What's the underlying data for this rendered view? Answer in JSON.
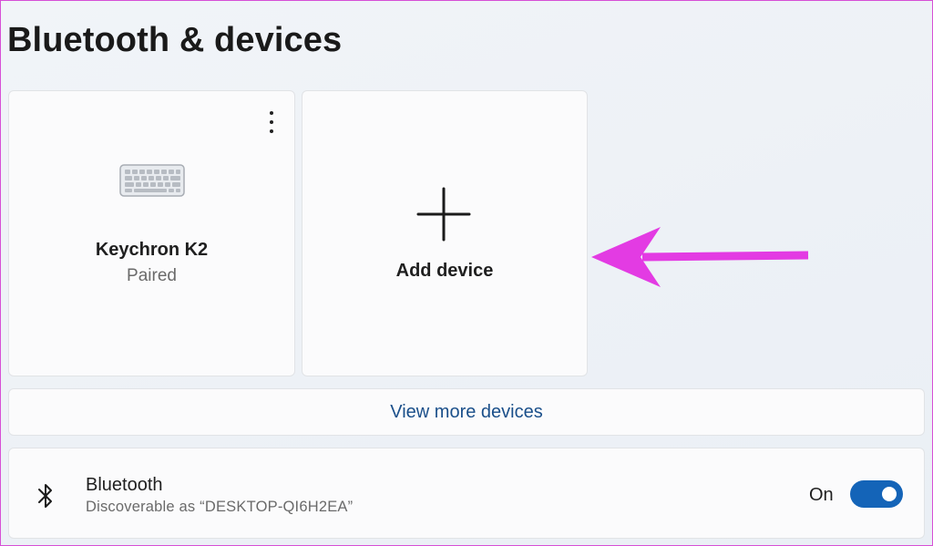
{
  "page": {
    "title": "Bluetooth & devices"
  },
  "device_card": {
    "name": "Keychron K2",
    "status": "Paired",
    "icon": "keyboard-icon",
    "menu_icon": "more-vertical-icon"
  },
  "add_card": {
    "label": "Add device",
    "icon": "plus-icon"
  },
  "view_more": {
    "label": "View more devices"
  },
  "bluetooth": {
    "title": "Bluetooth",
    "subtitle": "Discoverable as “DESKTOP-QI6H2EA”",
    "icon": "bluetooth-icon",
    "toggle_label": "On",
    "toggle_on": true
  },
  "colors": {
    "accent": "#1464b8",
    "link": "#1a4f8a",
    "annotation_arrow": "#e33be3"
  }
}
